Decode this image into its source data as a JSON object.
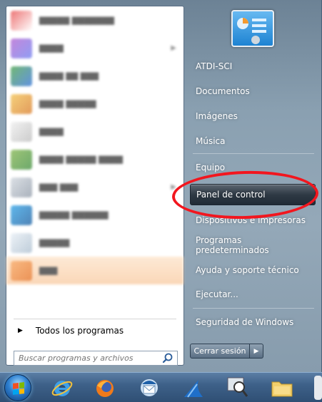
{
  "left_pane": {
    "all_programs_label": "Todos los programas",
    "search_placeholder": "Buscar programas y archivos"
  },
  "right_pane": {
    "items": [
      {
        "label": "ATDI-SCI"
      },
      {
        "label": "Documentos"
      },
      {
        "label": "Imágenes"
      },
      {
        "label": "Música"
      },
      {
        "label": "Equipo"
      },
      {
        "label": "Panel de control"
      },
      {
        "label": "Dispositivos e impresoras"
      },
      {
        "label": "Programas predeterminados"
      },
      {
        "label": "Ayuda y soporte técnico"
      },
      {
        "label": "Ejecutar..."
      },
      {
        "label": "Seguridad de Windows"
      }
    ],
    "selected_item": "Panel de control"
  },
  "shutdown": {
    "label": "Cerrar sesión"
  },
  "colors": {
    "highlight_ring": "#f2161e",
    "accent_blue": "#1e83d2"
  },
  "taskbar": {
    "icons": [
      "start-orb-icon",
      "internet-explorer-icon",
      "firefox-icon",
      "thunderbird-icon",
      "shark-fin-icon",
      "magnifier-app-icon",
      "folder-icon"
    ]
  }
}
